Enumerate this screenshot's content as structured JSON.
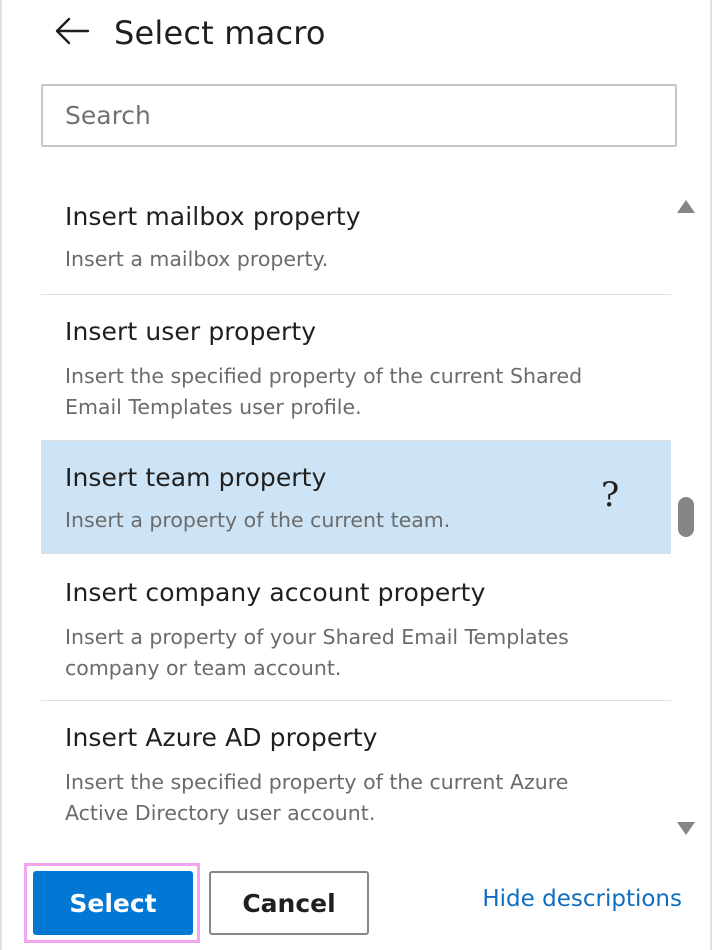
{
  "header": {
    "back_icon": "arrow-left-icon",
    "title": "Select macro"
  },
  "search": {
    "placeholder": "Search",
    "value": ""
  },
  "macros": [
    {
      "name": "Insert mailbox property",
      "description": "Insert a mailbox property.",
      "selected": false
    },
    {
      "name": "Insert user property",
      "description": "Insert the specified property of the current Shared Email Templates user profile.",
      "selected": false
    },
    {
      "name": "Insert team property",
      "description": "Insert a property of the current team.",
      "selected": true,
      "help_glyph": "?"
    },
    {
      "name": "Insert company account property",
      "description": "Insert a property of your Shared Email Templates company or team account.",
      "selected": false
    },
    {
      "name": "Insert Azure AD property",
      "description": "Insert the specified property of the current Azure Active Directory user account.",
      "selected": false
    }
  ],
  "footer": {
    "select_label": "Select",
    "cancel_label": "Cancel",
    "hide_descriptions_label": "Hide descriptions"
  },
  "colors": {
    "accent": "#0078d4",
    "selected_row": "#cce4f6",
    "link": "#106ebe",
    "highlight_outline": "#f2a6ef"
  }
}
